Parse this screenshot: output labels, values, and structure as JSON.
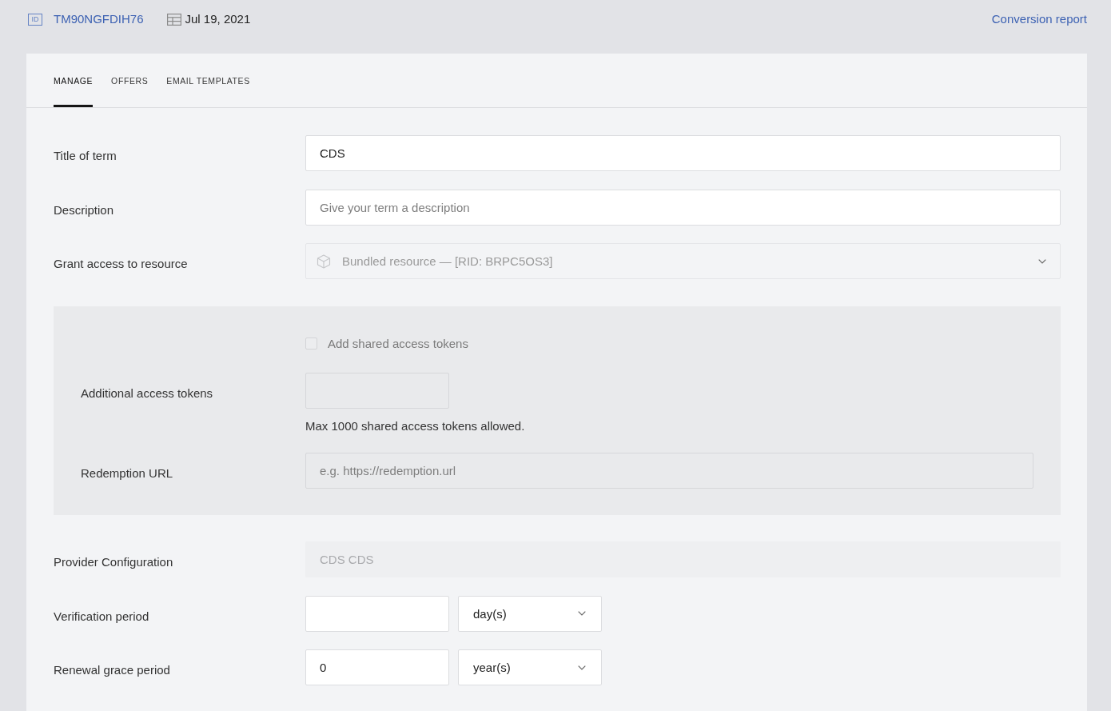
{
  "header": {
    "id_tag": "ID",
    "term_id": "TM90NGFDIH76",
    "date": "Jul 19, 2021",
    "report_link": "Conversion report"
  },
  "tabs": [
    {
      "label": "MANAGE",
      "selected": true
    },
    {
      "label": "OFFERS",
      "selected": false
    },
    {
      "label": "EMAIL TEMPLATES",
      "selected": false
    }
  ],
  "form": {
    "rows": [
      {
        "kind": "text",
        "label": "Title of term",
        "value": "CDS",
        "disabled": false
      },
      {
        "kind": "text",
        "label": "Description",
        "placeholder": "Give your term a description",
        "disabled": false
      },
      {
        "kind": "resource",
        "label": "Grant access to resource",
        "value": "Bundled resource — [RID: BRPC5OS3]",
        "disabled": true
      },
      {
        "kind": "group",
        "checkbox": {
          "label": "Add shared access tokens",
          "checked": false,
          "disabled": true
        },
        "rows": [
          {
            "kind": "count",
            "label": "Additional access tokens",
            "hint": "Max 1000 shared access tokens allowed."
          },
          {
            "kind": "url",
            "label": "Redemption URL",
            "placeholder": "e.g. https://redemption.url"
          }
        ]
      },
      {
        "kind": "text",
        "label": "Provider Configuration",
        "value": "CDS CDS",
        "disabled": true
      },
      {
        "kind": "duration",
        "label": "Verification period",
        "unit": "day(s)",
        "disabled": false
      },
      {
        "kind": "duration",
        "label": "Renewal grace period",
        "amount": "0",
        "unit": "year(s)",
        "disabled": false
      }
    ]
  }
}
